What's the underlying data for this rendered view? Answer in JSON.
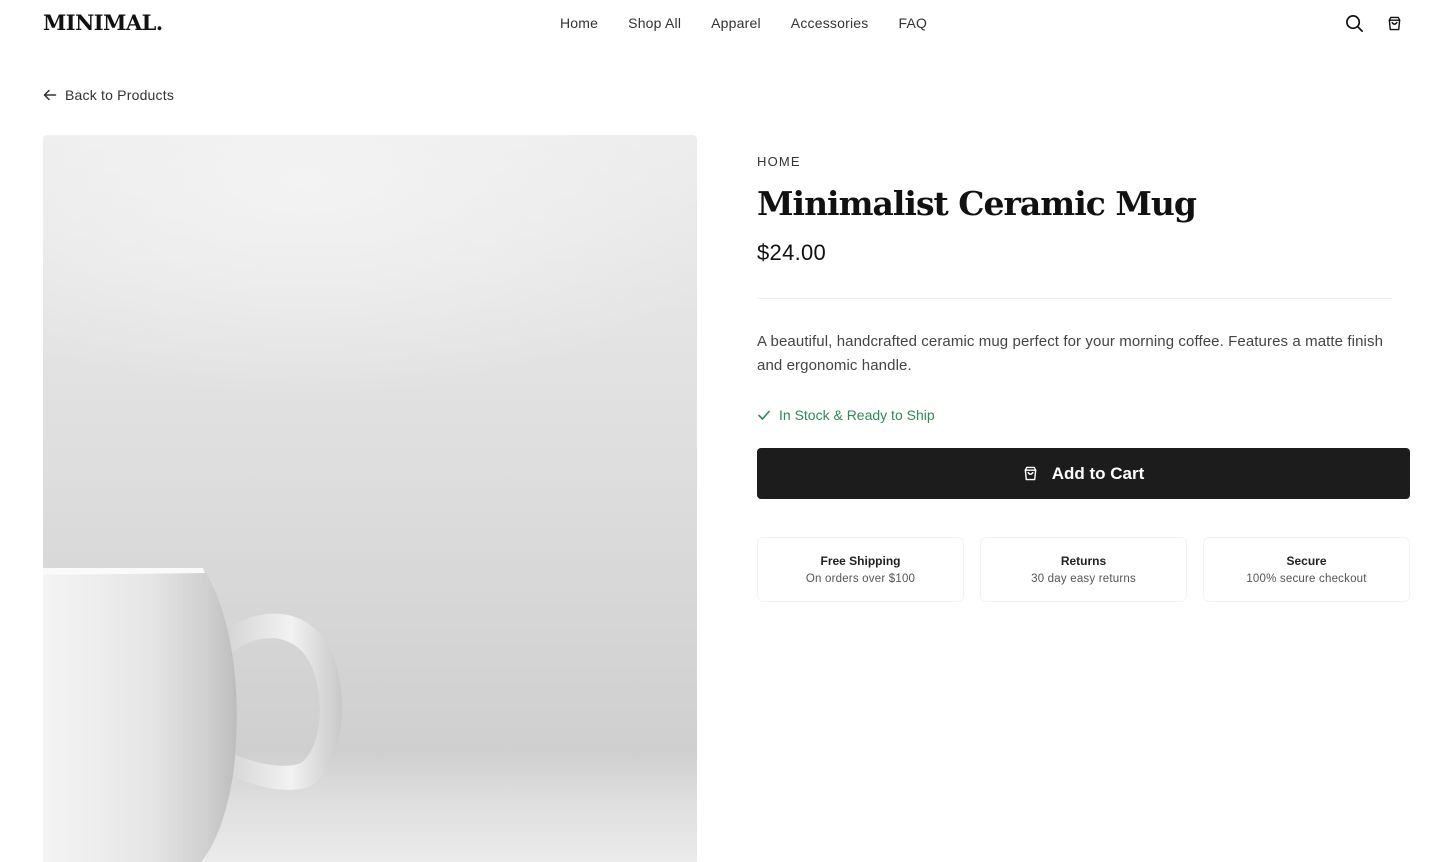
{
  "brand": {
    "logo": "MINIMAL."
  },
  "nav": {
    "items": [
      {
        "label": "Home"
      },
      {
        "label": "Shop All"
      },
      {
        "label": "Apparel"
      },
      {
        "label": "Accessories"
      },
      {
        "label": "FAQ"
      }
    ]
  },
  "header_icons": {
    "search": "search-icon",
    "cart": "shopping-bag-icon"
  },
  "back_link": {
    "label": "Back to Products",
    "icon": "arrow-left-icon"
  },
  "product": {
    "category": "HOME",
    "title": "Minimalist Ceramic Mug",
    "price": "$24.00",
    "description": "A beautiful, handcrafted ceramic mug perfect for your morning coffee. Features a matte finish and ergonomic handle.",
    "stock_status": "In Stock & Ready to Ship",
    "stock_color": "#2f8a57",
    "add_to_cart_label": "Add to Cart",
    "button_color": "#1c1c1c"
  },
  "features": [
    {
      "title": "Free Shipping",
      "subtitle": "On orders over $100"
    },
    {
      "title": "Returns",
      "subtitle": "30 day easy returns"
    },
    {
      "title": "Secure",
      "subtitle": "100% secure checkout"
    }
  ]
}
